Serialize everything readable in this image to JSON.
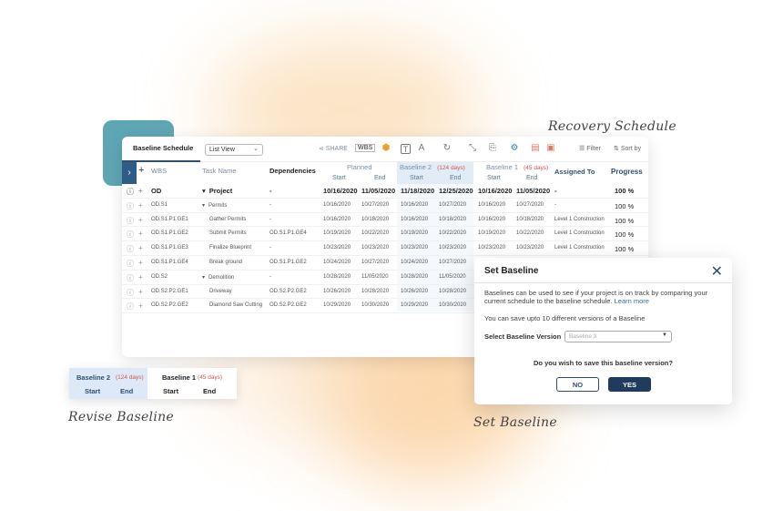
{
  "captions": {
    "recovery": "Recovery Schedule",
    "revise": "Revise Baseline",
    "set": "Set Baseline"
  },
  "toolbar": {
    "tab": "Baseline Schedule",
    "view_select": "List View",
    "share": "SHARE",
    "wbs": "WBS",
    "text_icon": "A",
    "filter": "Filter",
    "sort": "Sort by",
    "icons": [
      "share-icon",
      "wbs-icon",
      "cube-icon",
      "text-icon",
      "font-icon",
      "update-icon",
      "collapse-icon",
      "paint-icon",
      "settings-icon",
      "pdf-icon",
      "save-icon",
      "filter-icon",
      "sort-icon"
    ]
  },
  "columns": {
    "wbs": "WBS",
    "task": "Task Name",
    "dependencies": "Dependencies",
    "planned": "Planned",
    "baseline2": "Baseline 2",
    "baseline2_days": "(124 days)",
    "baseline1": "Baseline 1",
    "baseline1_days": "(45 days)",
    "assigned": "Assigned To",
    "progress": "Progress",
    "start": "Start",
    "end": "End"
  },
  "rows": [
    {
      "bold": true,
      "wbs": "OD",
      "task": "Project",
      "toggle": "▾",
      "dep": "-",
      "ps": "10/16/2020",
      "pe": "11/05/2020",
      "b2s": "11/18/2020",
      "b2e": "12/25/2020",
      "b1s": "10/16/2020",
      "b1e": "11/05/2020",
      "asg": "-",
      "prog": "100 %"
    },
    {
      "bold": false,
      "wbs": "OD.S1",
      "task": "Permits",
      "toggle": "▾",
      "dep": "-",
      "ps": "10/16/2020",
      "pe": "10/27/2020",
      "b2s": "10/16/2020",
      "b2e": "10/27/2020",
      "b1s": "10/16/2020",
      "b1e": "10/27/2020",
      "asg": "-",
      "prog": "100 %"
    },
    {
      "bold": false,
      "wbs": "OD.S1.P1.GE1",
      "task": "Gather Permits",
      "toggle": "",
      "dep": "-",
      "ps": "10/16/2020",
      "pe": "10/18/2020",
      "b2s": "10/16/2020",
      "b2e": "10/18/2020",
      "b1s": "10/16/2020",
      "b1e": "10/18/2020",
      "asg": "Level 1 Construction",
      "prog": "100 %"
    },
    {
      "bold": false,
      "wbs": "OD.S1.P1.GE2",
      "task": "Submit Permits",
      "toggle": "",
      "dep": "OD.S1.P1.GE4",
      "ps": "10/19/2020",
      "pe": "10/22/2020",
      "b2s": "10/19/2020",
      "b2e": "10/22/2020",
      "b1s": "10/19/2020",
      "b1e": "10/22/2020",
      "asg": "Level 1 Construction",
      "prog": "100 %"
    },
    {
      "bold": false,
      "wbs": "OD.S1.P1.GE3",
      "task": "Finalize Blueprint",
      "toggle": "",
      "dep": "-",
      "ps": "10/23/2020",
      "pe": "10/23/2020",
      "b2s": "10/23/2020",
      "b2e": "10/23/2020",
      "b1s": "10/23/2020",
      "b1e": "10/23/2020",
      "asg": "Level 1 Construction",
      "prog": "100 %"
    },
    {
      "bold": false,
      "wbs": "OD.S1.P1.GE4",
      "task": "Break ground",
      "toggle": "",
      "dep": "OD.S1.P1.GE2",
      "ps": "10/24/2020",
      "pe": "10/27/2020",
      "b2s": "10/24/2020",
      "b2e": "10/27/2020",
      "b1s": "",
      "b1e": "",
      "asg": "",
      "prog": ""
    },
    {
      "bold": false,
      "wbs": "OD.S2",
      "task": "Demolition",
      "toggle": "▾",
      "dep": "-",
      "ps": "10/28/2020",
      "pe": "11/05/2020",
      "b2s": "10/28/2020",
      "b2e": "11/05/2020",
      "b1s": "",
      "b1e": "",
      "asg": "",
      "prog": ""
    },
    {
      "bold": false,
      "wbs": "OD.S2.P2.GE1",
      "task": "Driveway",
      "toggle": "",
      "dep": "OD.S2.P2.GE2",
      "ps": "10/26/2020",
      "pe": "10/28/2020",
      "b2s": "10/26/2020",
      "b2e": "10/28/2020",
      "b1s": "",
      "b1e": "",
      "asg": "",
      "prog": ""
    },
    {
      "bold": false,
      "wbs": "OD.S2.P2.GE2",
      "task": "Diamond Saw Cutting",
      "toggle": "",
      "dep": "OD.S2.P2.GE2",
      "ps": "10/29/2020",
      "pe": "10/30/2020",
      "b2s": "10/29/2020",
      "b2e": "10/30/2020",
      "b1s": "",
      "b1e": "",
      "asg": "",
      "prog": ""
    }
  ],
  "mini_header": {
    "baseline2": "Baseline 2",
    "baseline2_days": "(124 days)",
    "baseline1": "Baseline 1",
    "baseline1_days": "(45 days)",
    "start": "Start",
    "end": "End"
  },
  "modal": {
    "title": "Set Baseline",
    "desc": "Baselines can be used to see if your project is on track by comparing your current schedule to the baseline schedule.",
    "link": "Learn more",
    "note": "You can save upto 10 different versions of a Baseline",
    "select_label": "Select Baseline Version",
    "select_placeholder": "Baseline 3",
    "question": "Do you wish to save this baseline version?",
    "no": "NO",
    "yes": "YES"
  },
  "colors": {
    "accent": "#2f4f72",
    "teal": "#5fa6b4",
    "highlight": "#e1ecf7",
    "days_red": "#d9534f",
    "glow": "#f7c38a"
  }
}
